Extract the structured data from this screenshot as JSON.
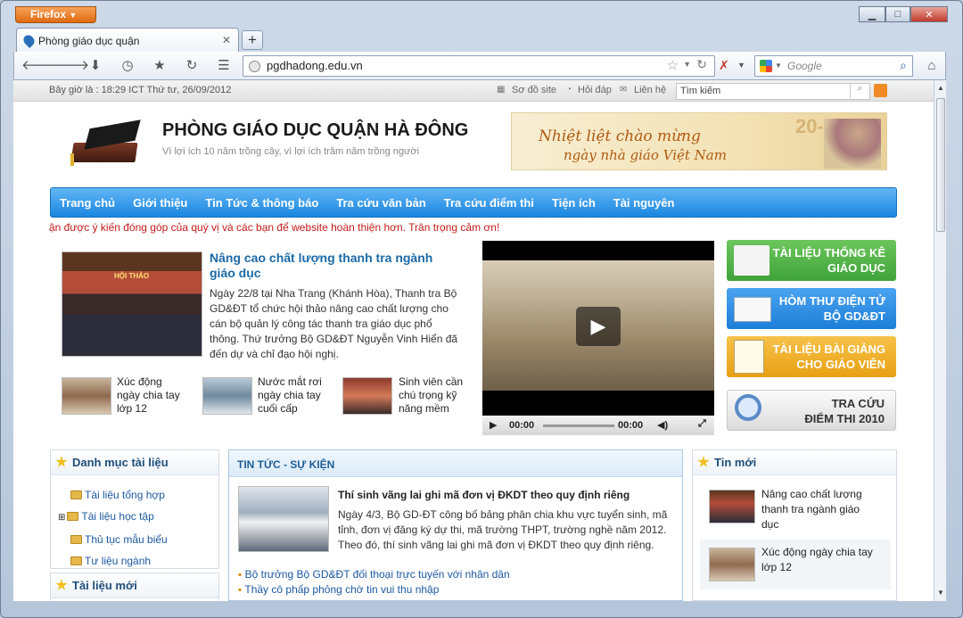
{
  "browser": {
    "app_button": "Firefox",
    "tab_title": "Phòng giáo dục quận",
    "url": "pgdhadong.edu.vn",
    "search_placeholder": "Google"
  },
  "site": {
    "datetime": "Bây giờ là : 18:29 ICT Thứ tư, 26/09/2012",
    "top_links": [
      "Sơ đồ site",
      "Hỏi đáp",
      "Liên hệ"
    ],
    "search_placeholder": "Tìm kiếm",
    "title": "PHÒNG GIÁO DỤC QUẬN HÀ ĐÔNG",
    "slogan": "Vì lợi ích 10 năm trồng cây, vì lợi ích trăm năm trồng người",
    "banner_text_1": "Nhiệt liệt chào mừng",
    "banner_text_2": "ngày nhà giáo Việt Nam",
    "banner_badge": "20-11",
    "menu": [
      "Trang chủ",
      "Giới thiệu",
      "Tin Tức & thông báo",
      "Tra cứu văn bản",
      "Tra cứu điểm thi",
      "Tiện ích",
      "Tài nguyên"
    ],
    "marquee": "ận được ý kiến đóng góp của quý vị và các bạn để website hoàn thiện hơn. Trân trọng cảm ơn!"
  },
  "featured": {
    "title": "Nâng cao chất lượng thanh tra ngành giáo dục",
    "body": "Ngày 22/8 tại Nha Trang (Khánh Hòa), Thanh tra Bộ GD&ĐT tổ chức hội thảo nâng cao chất lượng cho cán bộ quản lý công tác thanh tra giáo dục phổ thông. Thứ trưởng Bộ GD&ĐT Nguyễn Vinh Hiển đã đến dự và chỉ đạo hội nghị.",
    "photo_banner": "HỘI THẢO",
    "related": [
      "Xúc động ngày chia tay lớp 12",
      "Nước mắt rơi ngày chia tay cuối cấp",
      "Sinh viên cần chú trọng kỹ năng mềm"
    ]
  },
  "video": {
    "time_current": "00:00",
    "time_total": "00:00"
  },
  "quick_links": [
    {
      "line1": "TÀI LIỆU THỐNG KÊ",
      "line2": "GIÁO DỤC",
      "color": "#3fa33a"
    },
    {
      "line1": "HÒM THƯ ĐIỆN TỬ",
      "line2": "BỘ GD&ĐT",
      "color": "#1d7fd8"
    },
    {
      "line1": "TÀI LIỆU BÀI GIẢNG",
      "line2": "CHO GIÁO VIÊN",
      "color": "#e8a013"
    },
    {
      "line1": "TRA CỨU",
      "line2": "ĐIỂM THI 2010",
      "color": "#e6e6e6"
    }
  ],
  "left_panel": {
    "title": "Danh mục tài liệu",
    "items": [
      "Tài liệu tổng hợp",
      "Tài liệu học tập",
      "Thủ tục mẫu biểu",
      "Tư liệu ngành"
    ],
    "title2": "Tài liệu mới"
  },
  "news": {
    "header": "TIN TỨC - SỰ KIỆN",
    "title": "Thí sinh vãng lai ghi mã đơn vị ĐKDT theo quy định riêng",
    "body": "Ngày 4/3, Bộ GD-ĐT công bố bảng phân chia khu vực tuyển sinh, mã tỉnh, đơn vị đăng ký dự thi, mã trường THPT, trường nghề năm 2012. Theo đó, thí sinh vãng lai ghi mã đơn vị ĐKDT theo quy định riêng.",
    "links": [
      "Bộ trưởng Bộ GD&ĐT đối thoại trực tuyến với nhân dân",
      "Thầy cô phấp phỏng chờ tin vui thu nhập"
    ]
  },
  "right_panel": {
    "title": "Tin mới",
    "items": [
      "Nâng cao chất lượng thanh tra ngành giáo dục",
      "Xúc động ngày chia tay lớp 12"
    ]
  }
}
